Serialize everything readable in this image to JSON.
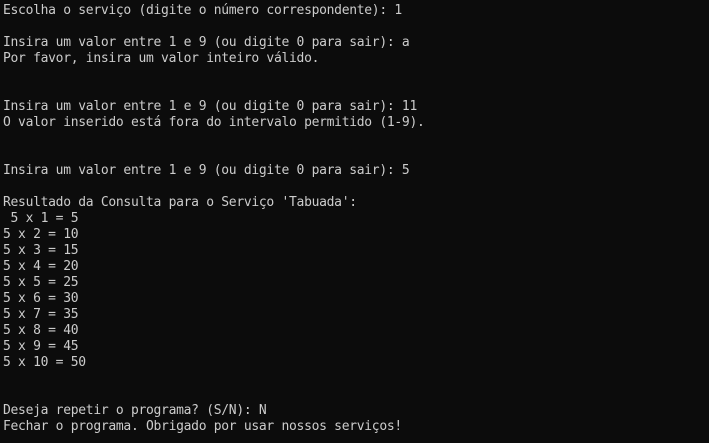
{
  "console": {
    "lines": [
      "Escolha o serviço (digite o número correspondente): 1",
      "",
      "Insira um valor entre 1 e 9 (ou digite 0 para sair): a",
      "Por favor, insira um valor inteiro válido.",
      "",
      "",
      "Insira um valor entre 1 e 9 (ou digite 0 para sair): 11",
      "O valor inserido está fora do intervalo permitido (1-9).",
      "",
      "",
      "Insira um valor entre 1 e 9 (ou digite 0 para sair): 5",
      "",
      "Resultado da Consulta para o Serviço 'Tabuada':",
      " 5 x 1 = 5",
      "5 x 2 = 10",
      "5 x 3 = 15",
      "5 x 4 = 20",
      "5 x 5 = 25",
      "5 x 6 = 30",
      "5 x 7 = 35",
      "5 x 8 = 40",
      "5 x 9 = 45",
      "5 x 10 = 50",
      "",
      "",
      "Deseja repetir o programa? (S/N): N",
      "Fechar o programa. Obrigado por usar nossos serviços!"
    ]
  }
}
